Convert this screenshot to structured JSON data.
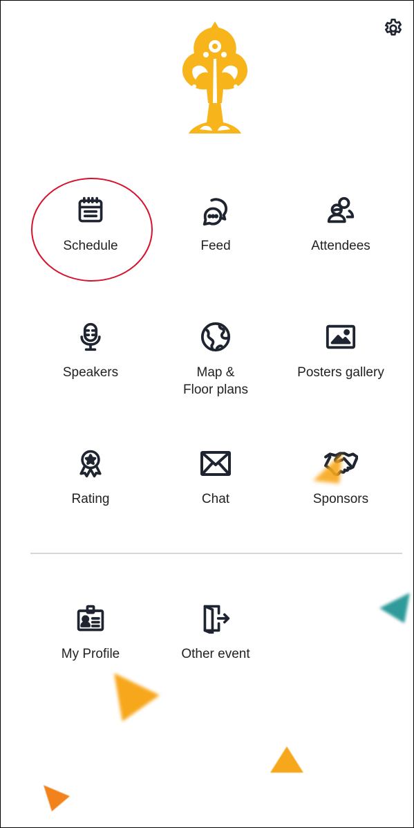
{
  "menu": {
    "schedule": "Schedule",
    "feed": "Feed",
    "attendees": "Attendees",
    "speakers": "Speakers",
    "map_line1": "Map &",
    "map_line2": "Floor plans",
    "posters": "Posters gallery",
    "rating": "Rating",
    "chat": "Chat",
    "sponsors": "Sponsors"
  },
  "secondary": {
    "profile": "My Profile",
    "other_event": "Other event"
  },
  "colors": {
    "logo": "#F7B51B",
    "highlight_circle": "#D8102B",
    "icon": "#1F2530",
    "deco_orange": "#F7A71C",
    "deco_teal": "#2F9A9A"
  },
  "icons": {
    "settings": "gear-icon",
    "schedule": "calendar-icon",
    "feed": "chat-bubbles-icon",
    "attendees": "people-icon",
    "speakers": "microphone-icon",
    "map": "globe-icon",
    "posters": "picture-icon",
    "rating": "award-ribbon-icon",
    "chat": "envelope-icon",
    "sponsors": "handshake-icon",
    "profile": "id-badge-icon",
    "other_event": "door-exit-icon"
  }
}
